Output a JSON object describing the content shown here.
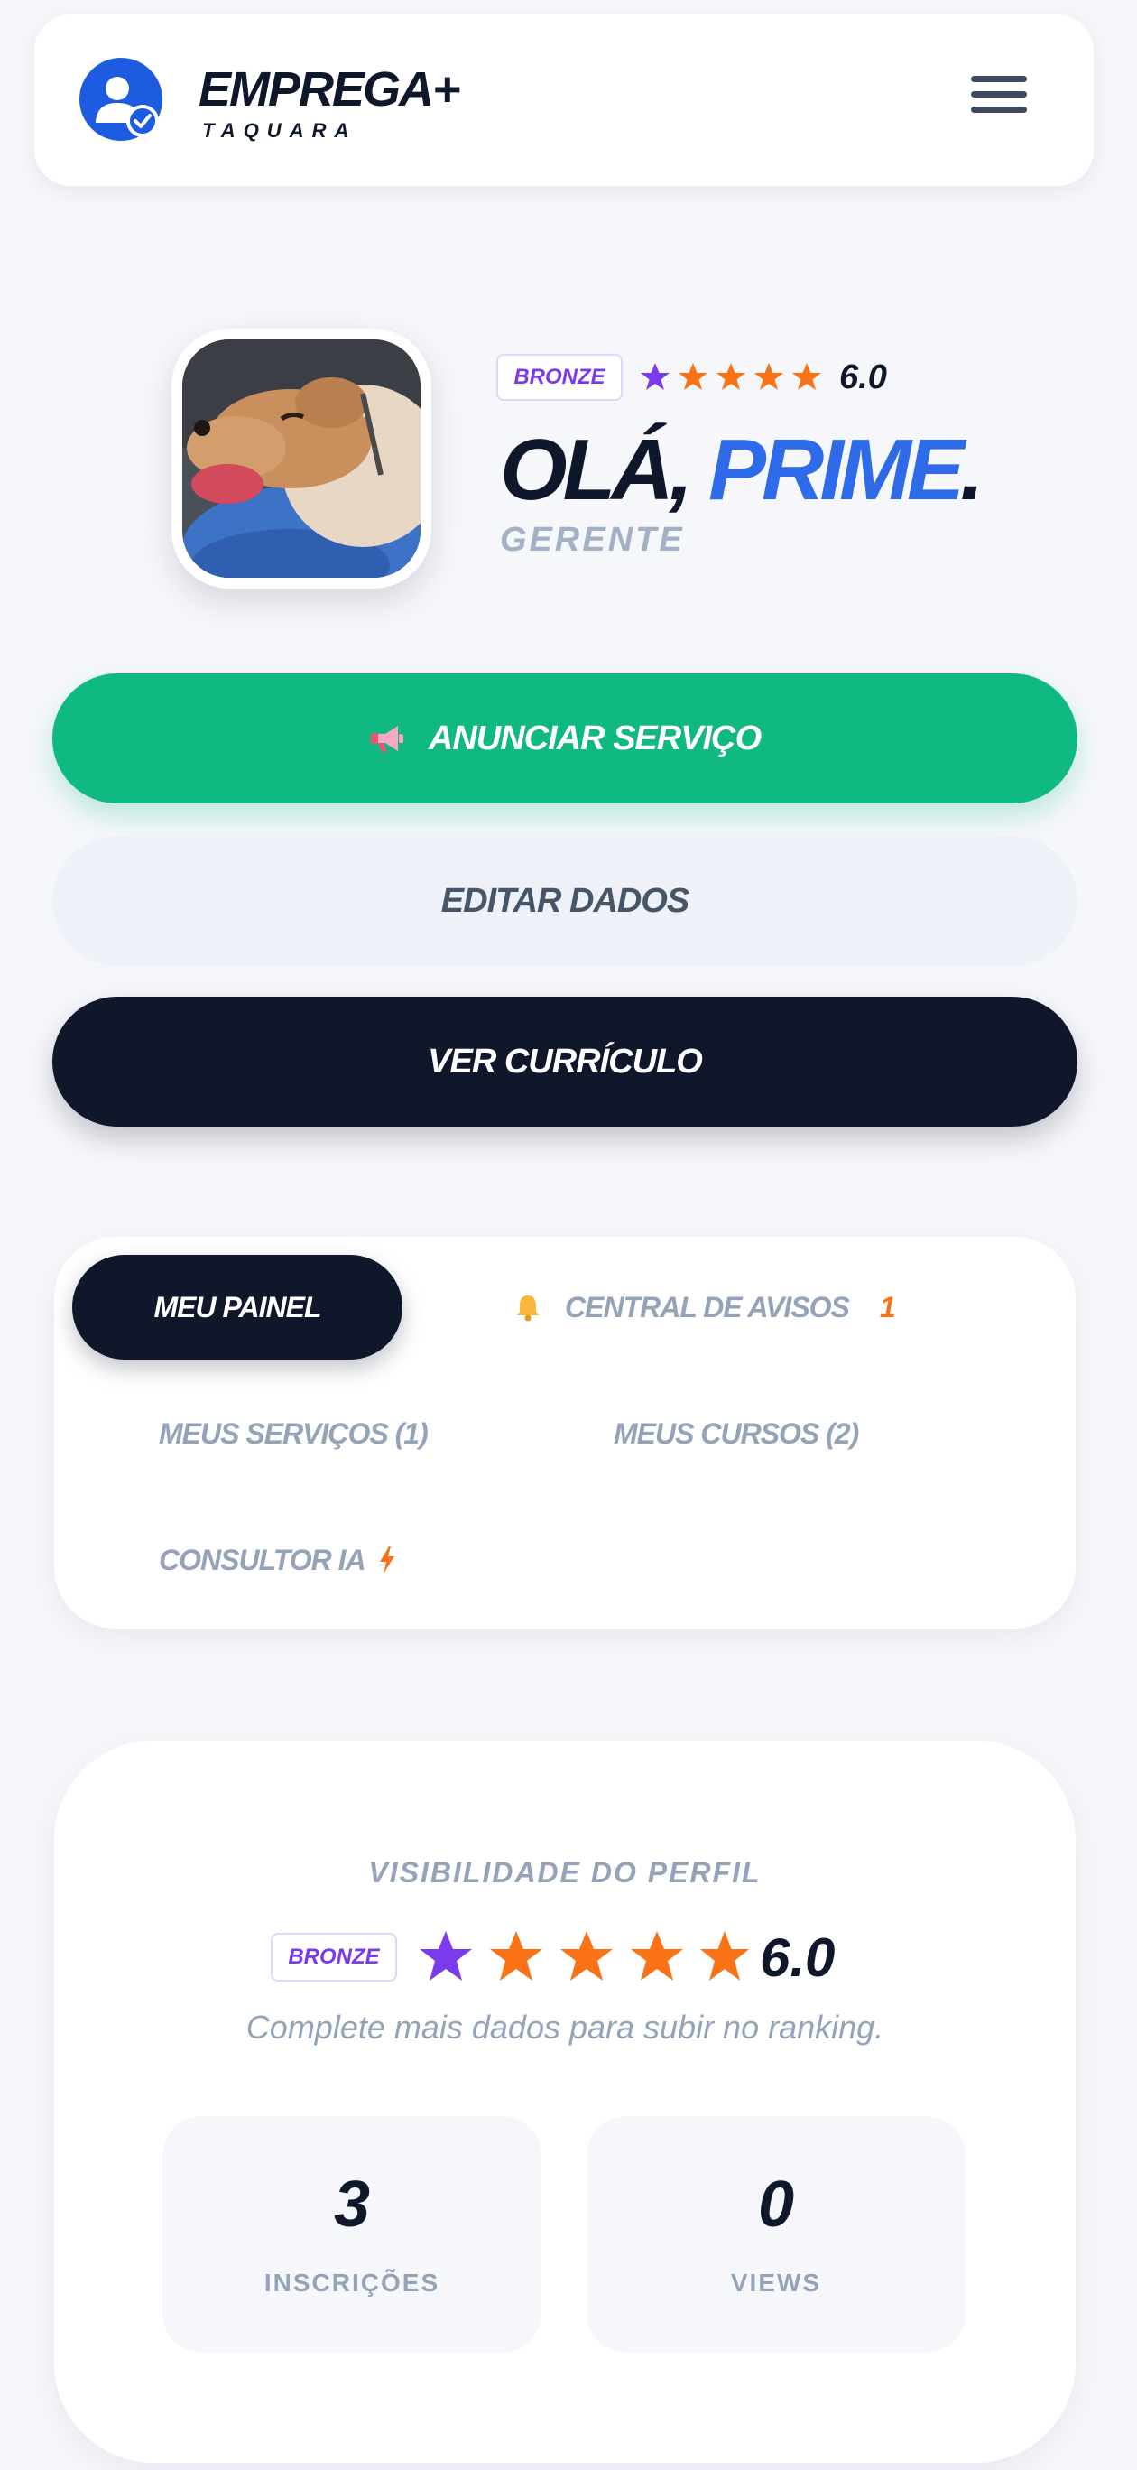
{
  "header": {
    "brand": "EMPREGA+",
    "brand_sub": "TAQUARA",
    "logo_icon": "user-check-icon",
    "menu_icon": "hamburger-icon"
  },
  "profile": {
    "badge": "BRONZE",
    "rating": "6.0",
    "stars": {
      "filled": 5,
      "first_color": "#7c3aed",
      "color": "#f97316"
    },
    "greeting_prefix": "OLÁ, ",
    "name": "PRIME",
    "greeting_suffix": ".",
    "role": "GERENTE"
  },
  "actions": {
    "announce_icon": "megaphone-icon",
    "announce": "ANUNCIAR SERVIÇO",
    "edit": "EDITAR DADOS",
    "resume": "VER CURRÍCULO"
  },
  "tabs": {
    "panel": "MEU PAINEL",
    "notices": "CENTRAL DE AVISOS",
    "notices_icon": "bell-icon",
    "notices_count": "1",
    "services": "MEUS SERVIÇOS (1)",
    "courses": "MEUS CURSOS (2)",
    "ai": "CONSULTOR IA",
    "ai_icon": "lightning-icon"
  },
  "visibility": {
    "title": "VISIBILIDADE DO PERFIL",
    "badge": "BRONZE",
    "rating": "6.0",
    "subtitle": "Complete mais dados para subir no ranking.",
    "stats": [
      {
        "value": "3",
        "label": "INSCRIÇÕES"
      },
      {
        "value": "0",
        "label": "VIEWS"
      }
    ]
  },
  "colors": {
    "accent_blue": "#2f6be8",
    "primary_green": "#10b981",
    "dark": "#11172b",
    "muted": "#94a3b8"
  }
}
